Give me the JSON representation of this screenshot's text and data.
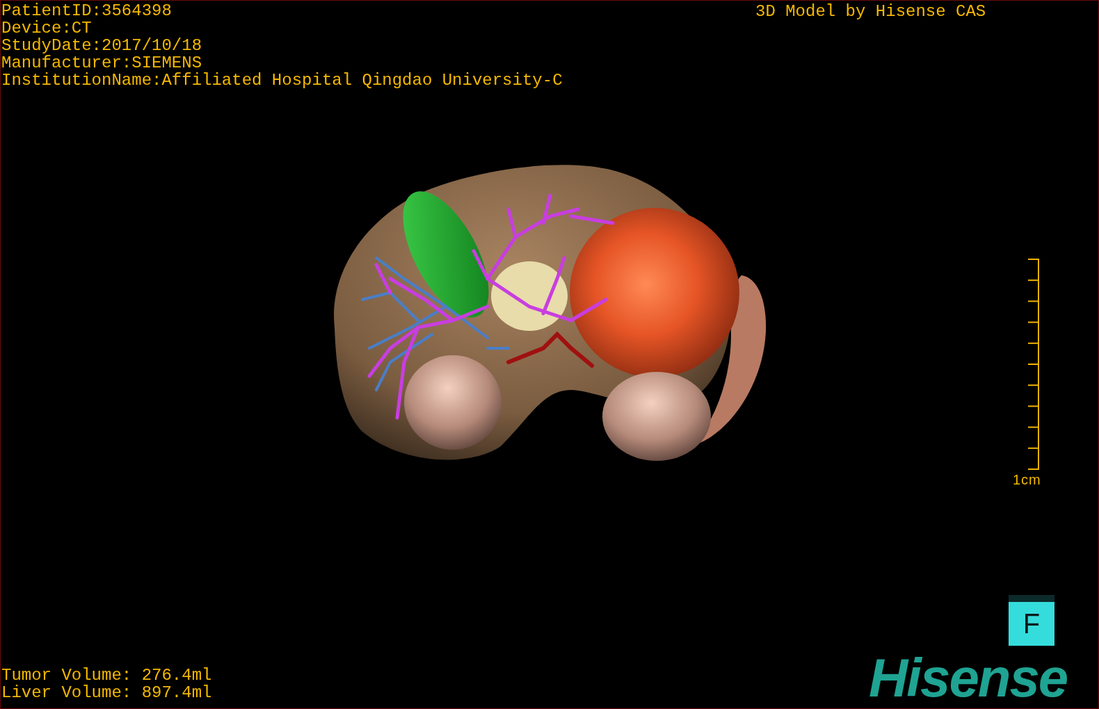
{
  "patient_info": [
    "PatientID:3564398",
    "Device:CT",
    "StudyDate:2017/10/18",
    "Manufacturer:SIEMENS",
    "InstitutionName:Affiliated Hospital Qingdao University-C"
  ],
  "title": "3D Model by Hisense CAS",
  "scale_bar": {
    "label": "1cm"
  },
  "orientation_cube": {
    "face": "F"
  },
  "volumes": [
    "Tumor Volume: 276.4ml",
    "Liver Volume: 897.4ml"
  ],
  "logo": "Hisense"
}
